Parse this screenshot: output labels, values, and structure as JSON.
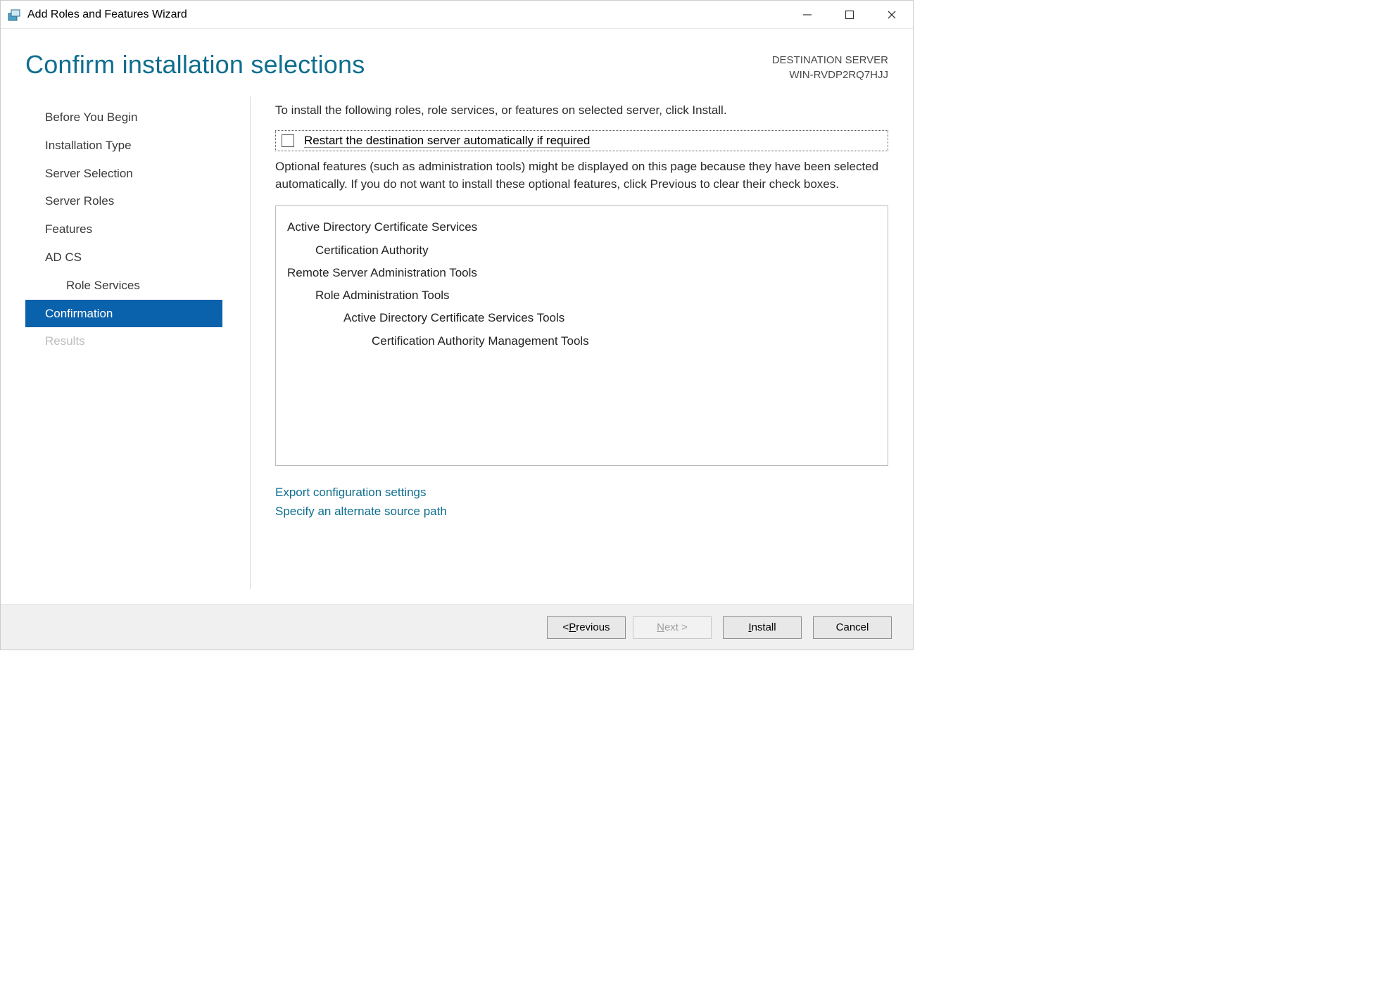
{
  "window": {
    "title": "Add Roles and Features Wizard"
  },
  "header": {
    "page_title": "Confirm installation selections",
    "destination_label": "DESTINATION SERVER",
    "destination_value": "WIN-RVDP2RQ7HJJ"
  },
  "sidebar": {
    "items": [
      {
        "label": "Before You Begin",
        "active": false,
        "sub": false,
        "disabled": false
      },
      {
        "label": "Installation Type",
        "active": false,
        "sub": false,
        "disabled": false
      },
      {
        "label": "Server Selection",
        "active": false,
        "sub": false,
        "disabled": false
      },
      {
        "label": "Server Roles",
        "active": false,
        "sub": false,
        "disabled": false
      },
      {
        "label": "Features",
        "active": false,
        "sub": false,
        "disabled": false
      },
      {
        "label": "AD CS",
        "active": false,
        "sub": false,
        "disabled": false
      },
      {
        "label": "Role Services",
        "active": false,
        "sub": true,
        "disabled": false
      },
      {
        "label": "Confirmation",
        "active": true,
        "sub": false,
        "disabled": false
      },
      {
        "label": "Results",
        "active": false,
        "sub": false,
        "disabled": true
      }
    ]
  },
  "main": {
    "instruction": "To install the following roles, role services, or features on selected server, click Install.",
    "restart_checkbox_label": "Restart the destination server automatically if required",
    "restart_checked": false,
    "optional_text": "Optional features (such as administration tools) might be displayed on this page because they have been selected automatically. If you do not want to install these optional features, click Previous to clear their check boxes.",
    "selection_tree": [
      {
        "text": "Active Directory Certificate Services",
        "indent": 0
      },
      {
        "text": "Certification Authority",
        "indent": 1
      },
      {
        "text": "Remote Server Administration Tools",
        "indent": 0
      },
      {
        "text": "Role Administration Tools",
        "indent": 1
      },
      {
        "text": "Active Directory Certificate Services Tools",
        "indent": 2
      },
      {
        "text": "Certification Authority Management Tools",
        "indent": 3
      }
    ],
    "links": {
      "export": "Export configuration settings",
      "alt_source": "Specify an alternate source path"
    }
  },
  "footer": {
    "previous": "< Previous",
    "next": "Next >",
    "install": "Install",
    "cancel": "Cancel"
  }
}
